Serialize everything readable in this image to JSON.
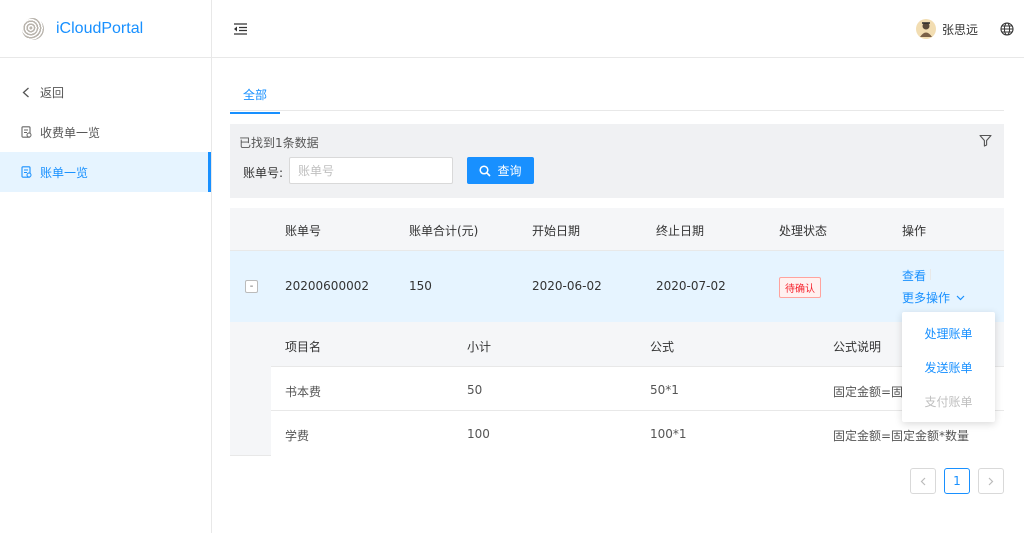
{
  "app": {
    "title": "iCloudPortal"
  },
  "sidebar": {
    "items": [
      {
        "label": "返回",
        "icon": "chevron-left-icon"
      },
      {
        "label": "收费单一览",
        "icon": "document-icon"
      },
      {
        "label": "账单一览",
        "icon": "document-icon",
        "active": true
      }
    ]
  },
  "header": {
    "user_name": "张思远",
    "accent": "#1890ff"
  },
  "tabs": [
    {
      "label": "全部",
      "active": true
    }
  ],
  "filter": {
    "result_text": "已找到1条数据",
    "field_label": "账单号:",
    "field_placeholder": "账单号",
    "search_label": "查询"
  },
  "table": {
    "headers": [
      "账单号",
      "账单合计(元)",
      "开始日期",
      "终止日期",
      "处理状态",
      "操作"
    ],
    "rows": [
      {
        "bill_no": "20200600002",
        "total": "150",
        "start": "2020-06-02",
        "end": "2020-07-02",
        "status": "待确认",
        "op_view": "查看",
        "op_more": "更多操作",
        "expand_symbol": "-"
      }
    ]
  },
  "sub_table": {
    "headers": [
      "项目名",
      "小计",
      "公式",
      "公式说明"
    ],
    "rows": [
      {
        "name": "书本费",
        "subtotal": "50",
        "formula": "50*1",
        "desc": "固定金额=固定"
      },
      {
        "name": "学费",
        "subtotal": "100",
        "formula": "100*1",
        "desc": "固定金额=固定金额*数量"
      }
    ]
  },
  "dropdown": {
    "items": [
      {
        "label": "处理账单",
        "disabled": false
      },
      {
        "label": "发送账单",
        "disabled": false
      },
      {
        "label": "支付账单",
        "disabled": true
      }
    ]
  },
  "pagination": {
    "current": "1"
  }
}
